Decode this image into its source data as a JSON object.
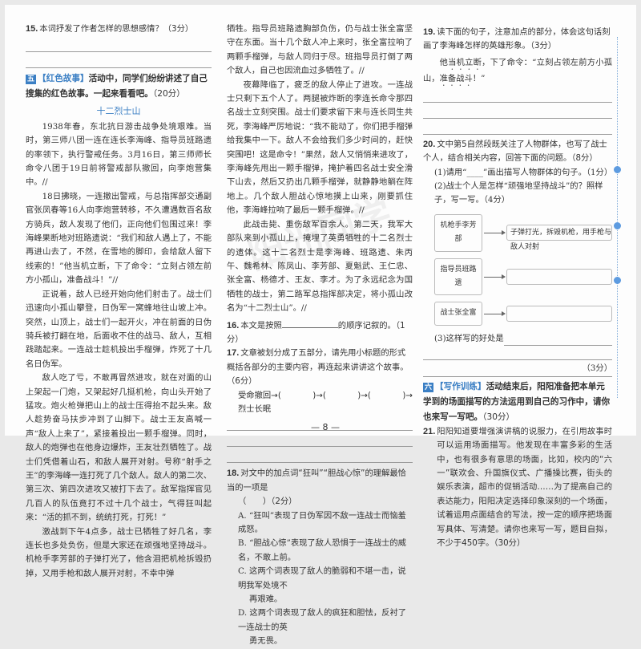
{
  "col1": {
    "q15": {
      "num": "15.",
      "text": "本词抒发了作者怎样的思想感情？（3分）"
    },
    "section5": {
      "badge": "五",
      "tag": "【红色故事】",
      "text": "活动中，同学们纷纷讲述了自己搜集的红色故事。一起来看看吧。",
      "score": "（20分）"
    },
    "story_title": "十二烈士山",
    "p1": "1938年春，东北抗日游击战争处境艰难。当时，第三师八团一连在连长李海峰、指导员班路遗的率领下，执行警戒任务。3月16日，第三师师长命令八团于19日前将警戒部队撤回，向李炮营集中。//",
    "p2": "18日拂晓，一连撤出警戒，与总指挥部交通副官张凤春等16人向李炮营转移，不久遭遇数百名敌方骑兵，敌人发现了他们，正向他们包围过来！李海峰果断地对班路遗说：“我们和敌人遇上了，不能再进山去了，不然，在雪地的脚印，会给敌人留下线索的！”他当机立断，下了命令：“立刻占领左前方小孤山，准备战斗！”//",
    "p3": "正说着，敌人已经开始向他们射击了。战士们迅速向小孤山攀登，日伪军一窝蜂地往山坡上冲。突然，山顶上，战士们一起开火，冲在前面的日伪骑兵被打翻在地，后面收不住的战马、敌人，互相践踏起来。一连战士趁机投出手榴弹，炸死了十几名日伪军。",
    "p4": "敌人吃了亏，不敢再冒然进攻，就在对面的山上架起一门炮，又架起好几挺机枪，向山头开始了猛攻。炮火枪弹把山上的战士压得抬不起头来。敌人趁势奋马扶步冲到了山脚下。战士王友高喊一声“敌人上来了”，紧接着投出一颗手榴弹。同时，敌人的炮弹也在他身边爆炸，王友壮烈牺牲了。战士们凭借着山石，和敌人展开对射。号称“射手之王”的李海峰一连打死了几个敌人。敌人的第二次、第三次、第四次进攻又被打下去了。敌军指挥官见几百人的队伍竟打不过十几个战士，气得狂叫起来：“活的抓不到，统统打死，打死！”",
    "p5": "激战到下午4点多，战士已牺牲了好几名，李连长也多处负伤，但是大家还在顽强地坚持战斗。机枪手李芳部的子弹打光了，他含泪把机枪拆毁扔掉，又用手枪和敌人展开对射，不幸中弹"
  },
  "col2": {
    "p5_cont": "牺牲。指导员班路遗胸部负伤，仍与战士张全富坚守在东面。当十几个敌人冲上来时，张全富拉响了两颗手榴弹，与敌人同归于尽。班指导员打倒了两个敌人，自己也因流血过多牺牲了。//",
    "p6": "夜幕降临了，疲乏的敌人停止了进攻。一连战士只剩下五个人了。两腿被炸断的李连长命令那四名战士立刻突围。战士们要求留下来与连长同生共死，李海峰严厉地说：“我不能动了，你们把手榴弹给我集中一下。敌人不会给我们多少时间的，赶快突围吧！这是命令！”果然，敌人又悄悄来进攻了，李海峰先甩出一颗手榴弹，掩护着四名战士安全滑下山去，然后又扔出几颗手榴弹，就静静地躺在阵地上。几个敌人胆战心惊地摸上山来，刚要抓住他，李海峰拉响了最后一颗手榴弹。//",
    "p7": "此战击毙、重伤敌军百余人。第二天，我军大部队来到小孤山上，掩埋了英勇牺牲的十二名烈士的遗体。这十二名烈士是李海峰、班路遗、朱丙午、魏希林、陈凤山、李芳部、夏魁武、王仁忠、张全富、杨德才、王友、李才。为了永远纪念为国牺牲的战士，第二路军总指挥部决定，将小孤山改名为“十二烈士山”。//",
    "q16": {
      "num": "16.",
      "before": "本文是按照",
      "after": "的顺序记叙的。（1分）"
    },
    "q17": {
      "num": "17.",
      "text": "文章被划分成了五部分，请先用小标题的形式概括各部分的主要内容，再连起来讲讲这个故事。（6分）",
      "flow_start": "受命撤回→(",
      "flow_mid1": ")→(",
      "flow_mid2": ")→(",
      "flow_end": ")→",
      "flow_last": "烈士长眠"
    },
    "q18": {
      "num": "18.",
      "text": "对文中的加点词“狂叫”“胆战心惊”的理解最恰当的一项是",
      "paren": "（　　）（2分）",
      "options": [
        "A. “狂叫”表现了日伪军因不敌一连战士而恼羞成怒。",
        "B. “胆战心惊”表现了敌人恐惧于一连战士的威名，不敢上前。",
        "C. 这两个词表现了敌人的脆弱和不堪一击，说明我军处境不",
        "再艰难。",
        "D. 这两个词表现了敌人的疯狂和胆怯，反衬了一连战士的英",
        "勇无畏。"
      ]
    },
    "page_number": "— 8 —"
  },
  "col3": {
    "q19": {
      "num": "19.",
      "text": "读下面的句子，注意加点的部分，体会这句话刻画了李海峰怎样的英雄形象。（3分）",
      "quote_a": "他",
      "quote_dotted1": "当机立断",
      "quote_b": "，下了命令：“立刻占领左前方小孤山，",
      "quote_dotted2": "准备战斗",
      "quote_c": "！”"
    },
    "q20": {
      "num": "20.",
      "text": "文中第5自然段既关注了人物群体，也写了战士个人，结合相关内容，回答下面的问题。（8分）",
      "sub1": "(1)请用“____”画出描写人物群体的句子。（1分）",
      "sub2": "(2)战士个人是怎样“顽强地坚持战斗”的？照样子，写一写。（4分）",
      "rows": [
        {
          "person": "机枪手李芳部",
          "action": "子弹打光，拆毁机枪，用手枪与敌人对射"
        },
        {
          "person": "指导员班路遗",
          "action": ""
        },
        {
          "person": "战士张全富",
          "action": ""
        }
      ],
      "sub3": "(3)这样写的好处是",
      "sub3_score": "（3分）"
    },
    "section6": {
      "badge": "六",
      "tag": "【写作训练】",
      "text": "活动结束后，阳阳准备把本单元学到的场面描写的方法运用到自己的习作中，请你也来写一写吧。",
      "score": "（30分）"
    },
    "q21": {
      "num": "21.",
      "text": "阳阳知道要增强演讲稿的说服力，在引用故事时可以运用场面描写。他发现在丰富多彩的生活中，也有很多有意思的场面，比如，校内的“六一”联欢会、升国旗仪式、广播操比赛，街头的娱乐表演，超市的促销活动……为了提高自己的表达能力，阳阳决定选择印象深刻的一个场面，试着运用点面结合的写法，按一定的顺序把场面写具体、写清楚。请你也来写一写，题目自拟，不少于450字。（30分）"
    }
  },
  "colors": {
    "accent": "#3b7fc4",
    "binding_dot": "#5d9be0"
  }
}
